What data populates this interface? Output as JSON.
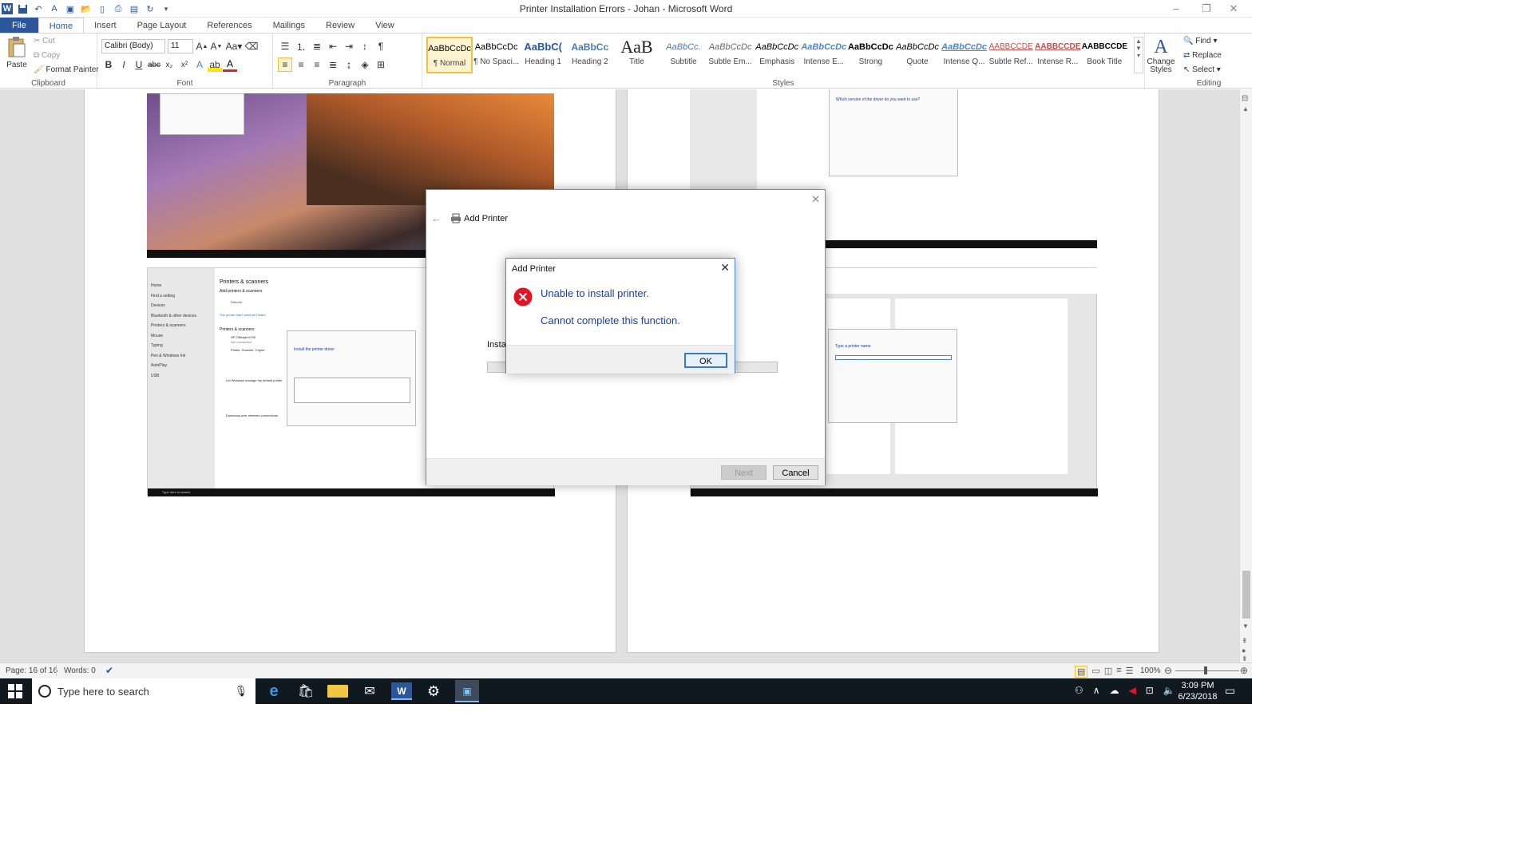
{
  "window": {
    "title": "Printer Installation Errors - Johan  -  Microsoft Word",
    "minimize": "–",
    "restore": "❐",
    "close": "✕"
  },
  "tabs": [
    "File",
    "Home",
    "Insert",
    "Page Layout",
    "References",
    "Mailings",
    "Review",
    "View"
  ],
  "active_tab": "Home",
  "ribbon": {
    "clipboard": {
      "paste": "Paste",
      "cut": "Cut",
      "copy": "Copy",
      "format_painter": "Format Painter",
      "label": "Clipboard"
    },
    "font": {
      "family": "Calibri (Body)",
      "size": "11",
      "label": "Font"
    },
    "paragraph": {
      "label": "Paragraph"
    },
    "styles": {
      "label": "Styles",
      "items": [
        {
          "preview": "AaBbCcDc",
          "name": "¶ Normal"
        },
        {
          "preview": "AaBbCcDc",
          "name": "¶ No Spaci..."
        },
        {
          "preview": "AaBbC(",
          "name": "Heading 1"
        },
        {
          "preview": "AaBbCc",
          "name": "Heading 2"
        },
        {
          "preview": "AaB",
          "name": "Title"
        },
        {
          "preview": "AaBbCc.",
          "name": "Subtitle"
        },
        {
          "preview": "AaBbCcDc",
          "name": "Subtle Em..."
        },
        {
          "preview": "AaBbCcDc",
          "name": "Emphasis"
        },
        {
          "preview": "AaBbCcDc",
          "name": "Intense E..."
        },
        {
          "preview": "AaBbCcDc",
          "name": "Strong"
        },
        {
          "preview": "AaBbCcDc",
          "name": "Quote"
        },
        {
          "preview": "AaBbCcDc",
          "name": "Intense Q..."
        },
        {
          "preview": "AABBCCDE",
          "name": "Subtle Ref..."
        },
        {
          "preview": "AABBCCDE",
          "name": "Intense R..."
        },
        {
          "preview": "AABBCCDE",
          "name": "Book Title"
        }
      ],
      "change_styles": "Change Styles"
    },
    "editing": {
      "find": "Find",
      "replace": "Replace",
      "select": "Select",
      "label": "Editing"
    }
  },
  "wizard": {
    "title": "Add Printer",
    "partial_text": "Install",
    "next": "Next",
    "cancel": "Cancel"
  },
  "error_dialog": {
    "title": "Add Printer",
    "message": "Unable to install printer.",
    "detail": "Cannot complete this function.",
    "ok": "OK"
  },
  "embedded": {
    "settings_heading": "Printers & scanners",
    "add_printers": "Add printers & scanners",
    "refresh": "Refresh",
    "not_listed": "The printer that I want isn't listed",
    "printers_heading": "Printers & scanners",
    "printer1": "HP Officejet 6700",
    "printer1_status": "Not connected",
    "printer2": "Printer, Scanner, Copier",
    "default_label": "Let Windows manage my default printer",
    "metered_label": "Download over metered connections",
    "nav": [
      "Home",
      "Find a setting",
      "Devices",
      "Bluetooth & other devices",
      "Printers & scanners",
      "Mouse",
      "Typing",
      "Pen & Windows Ink",
      "AutoPlay",
      "USB"
    ],
    "mini_wizard_title": "Install the printer driver",
    "driver_q": "Which version of the driver do you want to use?",
    "type_name": "Type a printer name",
    "search": "Type here to search"
  },
  "status": {
    "page": "Page: 16 of 16",
    "words": "Words: 0",
    "zoom": "100%"
  },
  "taskbar": {
    "search_placeholder": "Type here to search",
    "time": "3:09 PM",
    "date": "6/23/2018"
  },
  "colors": {
    "word_blue": "#2b579a",
    "error_red": "#e81123",
    "dialog_text_blue": "#1a3fa8",
    "taskbar": "#101820"
  }
}
